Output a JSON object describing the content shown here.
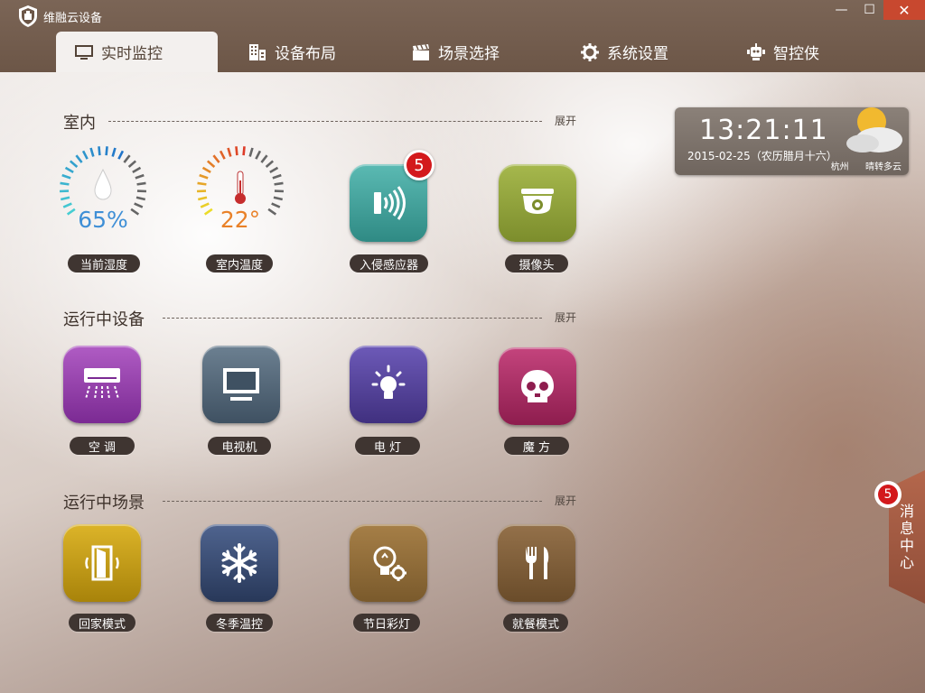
{
  "app": {
    "title": "维融云设备"
  },
  "window": {
    "minimize": "—",
    "maximize": "☐",
    "close": "✕"
  },
  "tabs": [
    {
      "label": "实时监控",
      "icon": "monitor-icon"
    },
    {
      "label": "设备布局",
      "icon": "building-icon"
    },
    {
      "label": "场景选择",
      "icon": "clapperboard-icon"
    },
    {
      "label": "系统设置",
      "icon": "gear-icon"
    },
    {
      "label": "智控侠",
      "icon": "robot-icon"
    }
  ],
  "sections": {
    "indoor": {
      "title": "室内",
      "expand": "展开",
      "humidity": {
        "value": "65%",
        "label": "当前湿度",
        "level": 0.65
      },
      "temperature": {
        "value": "22°",
        "label": "室内温度",
        "level": 0.55
      },
      "intrusion": {
        "label": "入侵感应器",
        "badge": "5"
      },
      "camera": {
        "label": "摄像头"
      }
    },
    "running_devices": {
      "title": "运行中设备",
      "expand": "展开",
      "items": [
        {
          "label": "空 调",
          "icon": "air-conditioner-icon"
        },
        {
          "label": "电视机",
          "icon": "tv-icon"
        },
        {
          "label": "电 灯",
          "icon": "light-bulb-icon"
        },
        {
          "label": "魔 方",
          "icon": "skull-icon"
        }
      ]
    },
    "running_scenes": {
      "title": "运行中场景",
      "expand": "展开",
      "items": [
        {
          "label": "回家模式",
          "icon": "door-icon"
        },
        {
          "label": "冬季温控",
          "icon": "snowflake-icon"
        },
        {
          "label": "节日彩灯",
          "icon": "bulb-gear-icon"
        },
        {
          "label": "就餐模式",
          "icon": "fork-knife-icon"
        }
      ]
    }
  },
  "clock": {
    "time": "13:21:11",
    "date": "2015-02-25（农历腊月十六）",
    "city": "杭州",
    "weather": "晴转多云"
  },
  "messages": {
    "label": "消息中心",
    "badge": "5"
  },
  "colors": {
    "humidity": "#3f8fd6",
    "temperature": "#e98128",
    "teal": "#3b9c98",
    "olive": "#8fa039",
    "purple": "#8d3ba3",
    "slate": "#4d6070",
    "indigo": "#4f3d95",
    "magenta": "#a3265e",
    "gold": "#cfa316",
    "navy": "#36486f",
    "brown": "#8d6a3a",
    "dark_brown": "#7a5b3a"
  }
}
